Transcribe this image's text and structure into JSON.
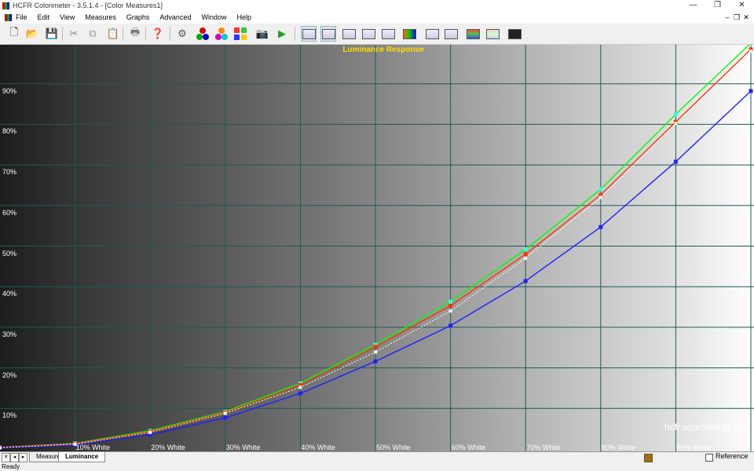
{
  "window": {
    "title": "HCFR Colorimeter - 3.5.1.4 - [Color Measures1]"
  },
  "menu": [
    "File",
    "Edit",
    "View",
    "Measures",
    "Graphs",
    "Advanced",
    "Window",
    "Help"
  ],
  "toolbar": {
    "buttons": [
      "new-document-icon",
      "open-folder-icon",
      "save-icon",
      "cut-icon",
      "copy-icon",
      "paste-icon",
      "print-icon",
      "help-icon",
      "sensor-icon",
      "rgb-balls-icon",
      "rgb-balls-alt-icon",
      "color-palette-icon",
      "camera-icon",
      "play-icon",
      "monitor-luminance-icon",
      "monitor-gamma-icon",
      "monitor-rgb-icon",
      "monitor-cie-icon",
      "monitor-white-icon",
      "monitor-video-icon",
      "monitor-sat-icon",
      "monitor-sat-alt-icon",
      "monitor-gray-icon",
      "monitor-bars-icon",
      "monitor-dark-icon"
    ]
  },
  "graph": {
    "watermark": "hcfr.sourceforge.net",
    "y_labels": [
      "90%",
      "80%",
      "70%",
      "60%",
      "50%",
      "40%",
      "30%",
      "20%",
      "10%"
    ],
    "x_labels": [
      "10% White",
      "20% White",
      "30% White",
      "40% White",
      "50% White",
      "60% White",
      "70% White",
      "80% White",
      "90% White"
    ]
  },
  "chart_data": {
    "type": "line",
    "title": "Luminance Response",
    "x": [
      0,
      10,
      20,
      30,
      40,
      50,
      60,
      70,
      80,
      90,
      100
    ],
    "ylim": [
      0,
      100
    ],
    "grid": true,
    "series": [
      {
        "color": "#00ff00",
        "values": [
          0.4,
          1.4,
          4.5,
          9.2,
          16.2,
          25.7,
          36.3,
          49.2,
          64.0,
          82.5,
          100
        ]
      },
      {
        "color": "#ff3300",
        "values": [
          0.4,
          1.3,
          4.3,
          9.0,
          15.8,
          25.2,
          35.3,
          48.0,
          62.6,
          80.6,
          98.5
        ]
      },
      {
        "color": "#2020ff",
        "values": [
          0.3,
          1.0,
          3.5,
          7.7,
          13.7,
          21.6,
          30.4,
          41.4,
          54.7,
          70.8,
          88.2
        ]
      },
      {
        "color": "#ffffff",
        "dashed": true,
        "values": [
          0.3,
          1.2,
          4.1,
          8.8,
          15.2,
          23.9,
          34.0,
          47.0,
          62.0,
          80.2,
          98.0
        ]
      }
    ]
  },
  "tabs": [
    "Measures",
    "Luminance"
  ],
  "active_tab": "Luminance",
  "reference_label": "Reference",
  "status": "Ready"
}
